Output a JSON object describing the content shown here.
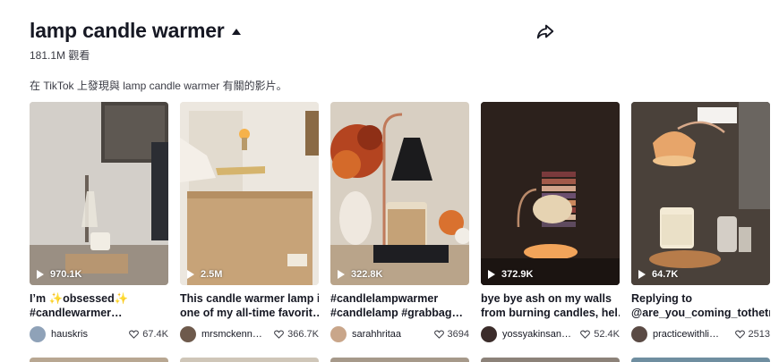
{
  "header": {
    "title": "lamp candle warmer",
    "views": "181.1M 觀看",
    "description": "在 TikTok 上發現與 lamp candle warmer 有關的影片。"
  },
  "icons": {
    "collapse": "caret-up-icon",
    "share": "share-arrow-icon",
    "play": "play-icon",
    "like": "heart-outline-icon"
  },
  "videos": [
    {
      "play_count": "970.1K",
      "caption_line1": "I’m ✨obsessed✨",
      "caption_line2": "#candlewarmer…",
      "username": "hauskris",
      "likes": "67.4K"
    },
    {
      "play_count": "2.5M",
      "caption_line1": "This candle warmer lamp is",
      "caption_line2": "one of my all-time favorit…",
      "username": "mrsmckenn…",
      "likes": "366.7K"
    },
    {
      "play_count": "322.8K",
      "caption_line1": "#candlelampwarmer",
      "caption_line2": "#candlelamp #grabbag…",
      "username": "sarahhritaa",
      "likes": "3694"
    },
    {
      "play_count": "372.9K",
      "caption_line1": "bye bye ash on my walls",
      "caption_line2": "from burning candles, hel…",
      "username": "yossyakinsan…",
      "likes": "52.4K"
    },
    {
      "play_count": "64.7K",
      "caption_line1": "Replying to",
      "caption_line2": "@are_you_coming_tothetr…",
      "username": "practicewithli…",
      "likes": "2513"
    }
  ]
}
